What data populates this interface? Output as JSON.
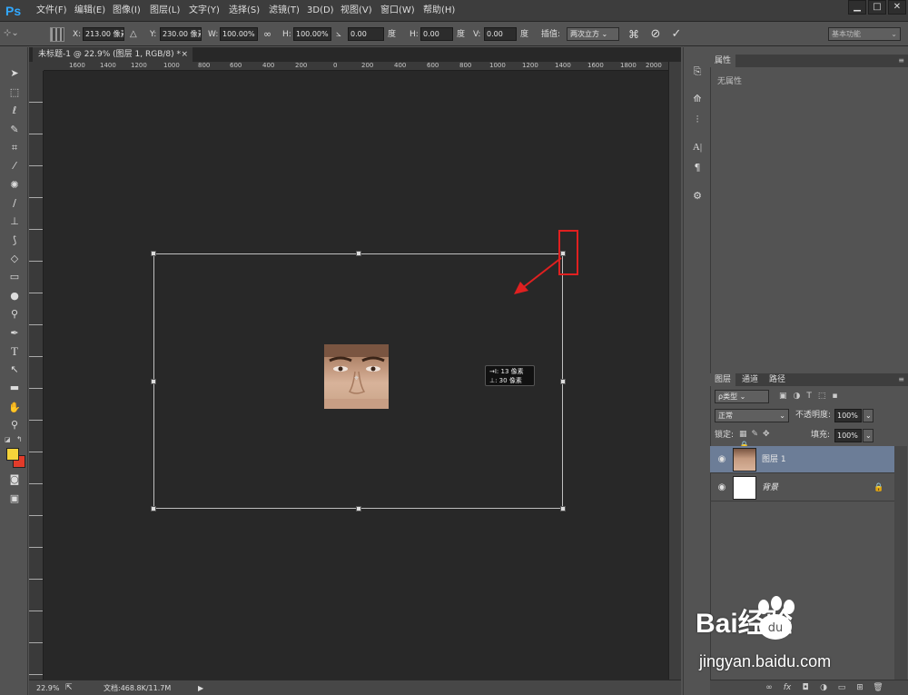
{
  "app": {
    "logo": "Ps",
    "accent": "#31a8ff"
  },
  "menu": [
    "文件(F)",
    "编辑(E)",
    "图像(I)",
    "图层(L)",
    "文字(Y)",
    "选择(S)",
    "滤镜(T)",
    "3D(D)",
    "视图(V)",
    "窗口(W)",
    "帮助(H)"
  ],
  "window_controls": {
    "minimize": "▁",
    "maximize": "□",
    "close": "✕"
  },
  "options": {
    "x_label": "X:",
    "x_value": "213.00 像素",
    "delta_label": "△",
    "y_label": "Y:",
    "y_value": "230.00 像素",
    "w_label": "W:",
    "w_value": "100.00%",
    "link_label": "∞",
    "h_label": "H:",
    "h_value": "100.00%",
    "angle_value": "0.00",
    "angle_unit": "度",
    "hskew_label": "H:",
    "hskew_value": "0.00",
    "hskew_unit": "度",
    "vskew_label": "V:",
    "vskew_value": "0.00",
    "vskew_unit": "度",
    "interp_label": "插值:",
    "interp_value": "两次立方",
    "workspace": "基本功能"
  },
  "document": {
    "tab_title": "未标题-1 @ 22.9% (图层 1, RGB/8) *",
    "tab_close": "×",
    "ruler_ticks": [
      "1600",
      "1400",
      "1200",
      "1000",
      "800",
      "600",
      "400",
      "200",
      "0",
      "200",
      "400",
      "600",
      "800",
      "1000",
      "1200",
      "1400",
      "1600",
      "1800",
      "2000"
    ]
  },
  "tooltip": {
    "line1": "→I: 13 像素",
    "line2": "⊥: 30 像素"
  },
  "status": {
    "zoom": "22.9%",
    "doc": "文档:468.8K/11.7M"
  },
  "properties": {
    "tab": "属性",
    "content": "无属性"
  },
  "layers_panel": {
    "tabs": [
      "图层",
      "通道",
      "路径"
    ],
    "filter": "ρ类型",
    "blend": "正常",
    "opacity_label": "不透明度:",
    "opacity_value": "100%",
    "lock_label": "锁定:",
    "fill_label": "填充:",
    "fill_value": "100%",
    "layers": [
      {
        "name": "图层 1"
      },
      {
        "name": "背景"
      }
    ]
  },
  "colors": {
    "foreground": "#f5d33a",
    "background": "#e23b2a",
    "highlight": "#e02020",
    "layer_selected": "#6c7d97"
  },
  "watermark": {
    "brand": "Bai经验",
    "url": "jingyan.baidu.com"
  }
}
